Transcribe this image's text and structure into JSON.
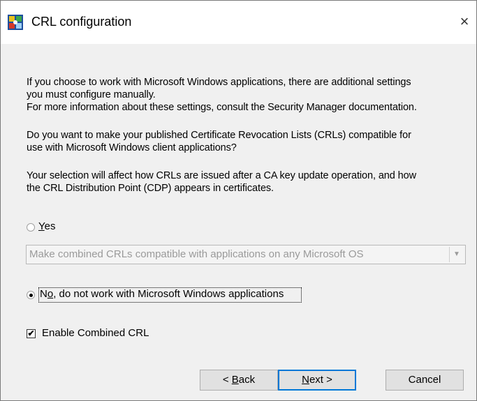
{
  "window": {
    "title": "CRL configuration",
    "close_glyph": "×",
    "icon": "crl-app-icon"
  },
  "content": {
    "para1": "If you choose to work with Microsoft Windows applications, there are additional settings\nyou must configure manually.\nFor more information about these settings, consult the Security Manager documentation.",
    "para2": "Do you want to make your published Certificate Revocation Lists (CRLs) compatible for\nuse with Microsoft Windows client applications?",
    "para3": "Your selection will affect how CRLs are issued after a CA key update operation, and how\nthe CRL Distribution Point (CDP) appears in certificates."
  },
  "options": {
    "yes": {
      "accel": "Y",
      "rest": "es",
      "checked": false
    },
    "combo": {
      "value": "Make combined CRLs compatible with applications on any Microsoft OS",
      "enabled": false
    },
    "no": {
      "prefix": "N",
      "accel": "o",
      "rest": ", do not work with Microsoft Windows applications",
      "checked": true
    },
    "enable_combined": {
      "label": "Enable Combined CRL",
      "checked": true
    }
  },
  "buttons": {
    "back": {
      "prefix": "< ",
      "accel": "B",
      "rest": "ack"
    },
    "next": {
      "accel": "N",
      "rest": "ext >"
    },
    "cancel": "Cancel"
  }
}
